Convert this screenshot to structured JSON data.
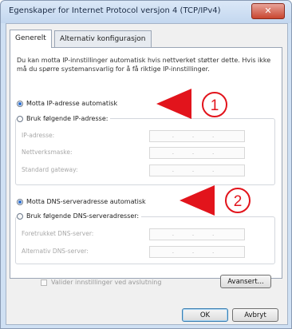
{
  "window": {
    "title": "Egenskaper for Internet Protocol versjon 4 (TCP/IPv4)",
    "close_label": "✕"
  },
  "tabs": [
    {
      "label": "Generelt"
    },
    {
      "label": "Alternativ konfigurasjon"
    }
  ],
  "description": "Du kan motta IP-innstillinger automatisk hvis nettverket støtter dette. Hvis ikke må du spørre systemansvarlig for å få riktige IP-innstillinger.",
  "ip_section": {
    "auto_label": "Motta IP-adresse automatisk",
    "manual_label": "Bruk følgende IP-adresse:",
    "selected": "auto",
    "fields": [
      {
        "label": "IP-adresse:",
        "value": ". . ."
      },
      {
        "label": "Nettverksmaske:",
        "value": ". . ."
      },
      {
        "label": "Standard gateway:",
        "value": ". . ."
      }
    ]
  },
  "dns_section": {
    "auto_label": "Motta DNS-serveradresse automatisk",
    "manual_label": "Bruk følgende DNS-serveradresser:",
    "selected": "auto",
    "fields": [
      {
        "label": "Foretrukket DNS-server:",
        "value": ". . ."
      },
      {
        "label": "Alternativ DNS-server:",
        "value": ". . ."
      }
    ]
  },
  "validate_checkbox": {
    "label": "Valider innstillinger ved avslutning",
    "checked": false
  },
  "buttons": {
    "advanced": "Avansert...",
    "ok": "OK",
    "cancel": "Avbryt"
  },
  "callouts": [
    {
      "number": "1"
    },
    {
      "number": "2"
    }
  ],
  "colors": {
    "callout": "#e2141c",
    "radio_selected": "#2c6fd1"
  }
}
